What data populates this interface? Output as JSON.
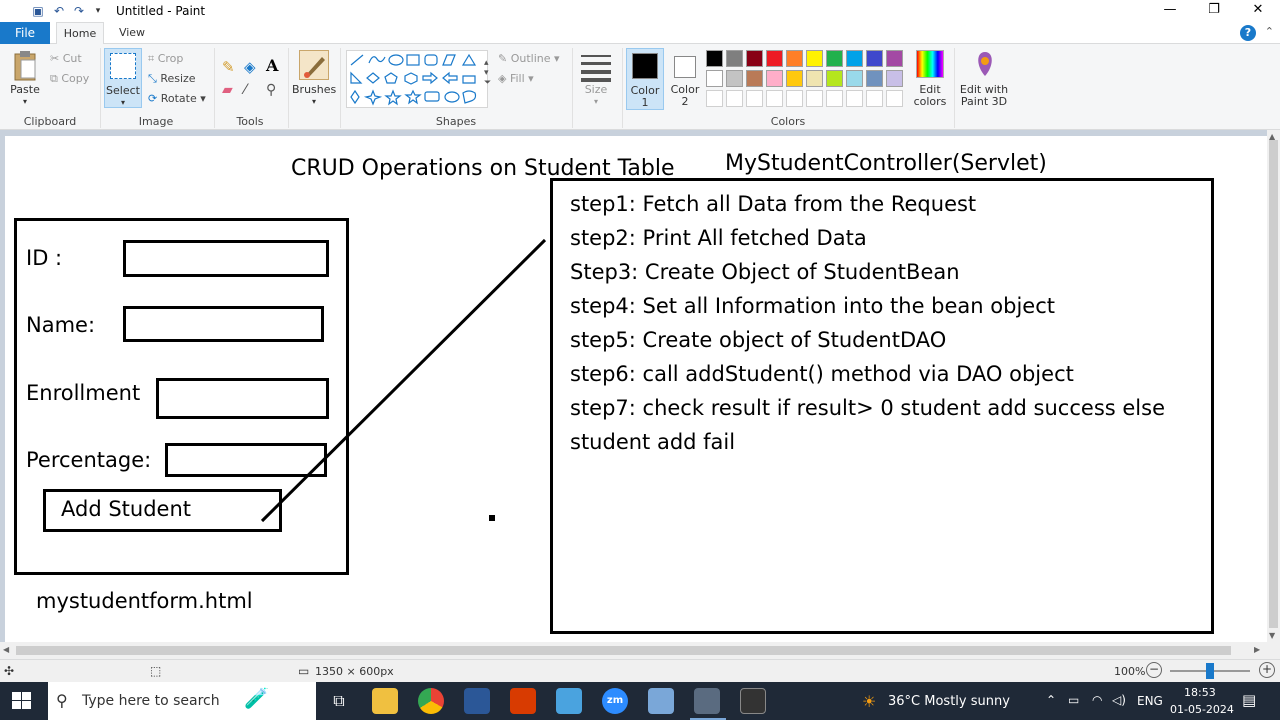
{
  "window": {
    "title": "Untitled - Paint",
    "minimize": "—",
    "maximize": "❐",
    "close": "✕"
  },
  "tabs": {
    "file": "File",
    "home": "Home",
    "view": "View"
  },
  "ribbon": {
    "clipboard": {
      "paste": "Paste",
      "cut": "Cut",
      "copy": "Copy",
      "label": "Clipboard"
    },
    "image": {
      "select": "Select",
      "crop": "Crop",
      "resize": "Resize",
      "rotate": "Rotate",
      "label": "Image"
    },
    "tools": {
      "label": "Tools"
    },
    "brushes": {
      "label": "Brushes"
    },
    "shapes": {
      "outline": "Outline",
      "fill": "Fill",
      "label": "Shapes"
    },
    "size": {
      "label": "Size"
    },
    "colors": {
      "color1": "Color\n1",
      "color1_a": "Color",
      "color1_b": "1",
      "color2_a": "Color",
      "color2_b": "2",
      "edit_a": "Edit",
      "edit_b": "colors",
      "paint3d_a": "Edit with",
      "paint3d_b": "Paint 3D",
      "label": "Colors",
      "color1_value": "#000000",
      "color2_value": "#ffffff",
      "palette_row1": [
        "#000000",
        "#7f7f7f",
        "#880015",
        "#ed1c24",
        "#ff7f27",
        "#fff200",
        "#22b14c",
        "#00a2e8",
        "#3f48cc",
        "#a349a4"
      ],
      "palette_row2": [
        "#ffffff",
        "#c3c3c3",
        "#b97a57",
        "#ffaec9",
        "#ffc90e",
        "#efe4b0",
        "#b5e61d",
        "#99d9ea",
        "#7092be",
        "#c8bfe7"
      ]
    }
  },
  "canvas": {
    "heading": "CRUD Operations on Student Table",
    "form_caption": "mystudentform.html",
    "form": {
      "id_label": "ID :",
      "name_label": "Name:",
      "enrollment_label": "Enrollment",
      "percentage_label": "Percentage:",
      "button": "Add Student"
    },
    "controller_title": "MyStudentController(Servlet)",
    "steps": [
      "step1: Fetch all Data from the Request",
      "step2: Print All fetched Data",
      "Step3: Create Object of StudentBean",
      "step4: Set all Information into the bean object",
      "step5: Create object of StudentDAO",
      "step6: call addStudent() method  via DAO object",
      "step7: check result if result> 0 student add success else",
      "student add fail"
    ]
  },
  "status": {
    "dimensions": "1350 × 600px",
    "zoom": "100%"
  },
  "taskbar": {
    "search_placeholder": "Type here to search",
    "weather": "36°C  Mostly sunny",
    "language": "ENG",
    "time": "18:53",
    "date": "01-05-2024"
  }
}
